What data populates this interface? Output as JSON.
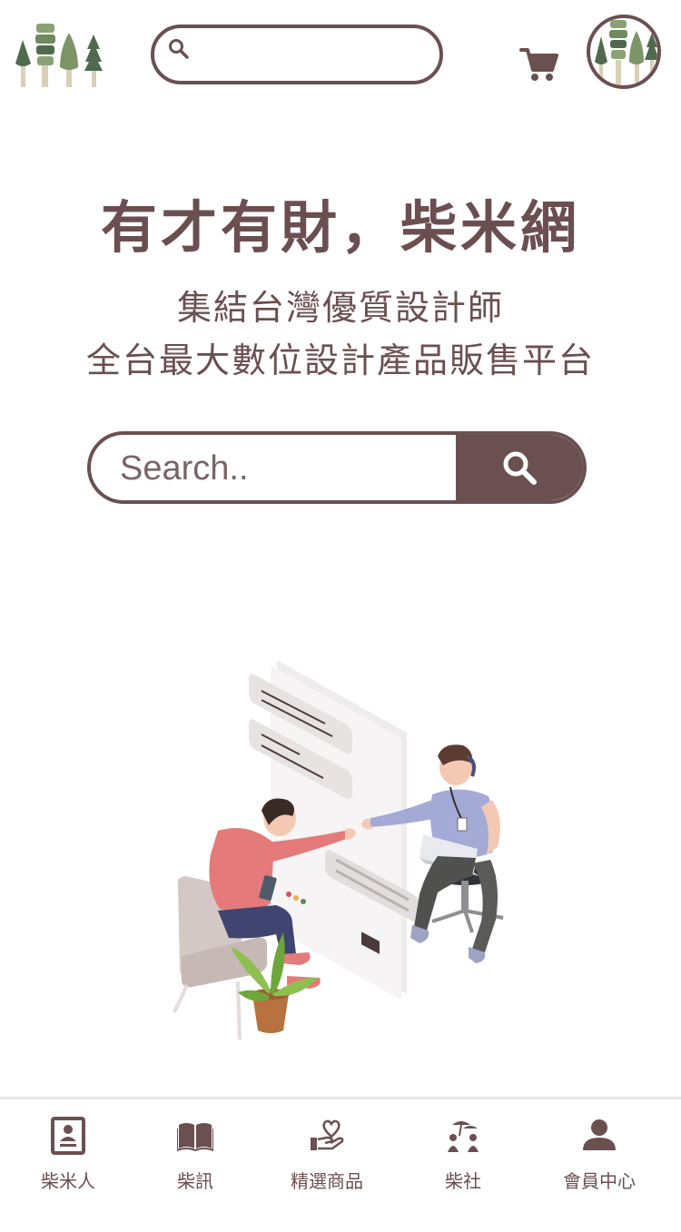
{
  "header": {
    "logo_icon": "trees-logo-icon",
    "search_icon": "search-icon",
    "search_value": "",
    "cart_icon": "cart-icon",
    "avatar_icon": "avatar-trees-icon"
  },
  "hero": {
    "title": "有才有財，柴米網",
    "subtitle_line1": "集結台灣優質設計師",
    "subtitle_line2": "全台最大數位設計產品販售平台",
    "search_placeholder": "Search..",
    "search_button_icon": "search-icon"
  },
  "illustration": {
    "icon": "designers-handshake-illustration"
  },
  "bottom_nav": {
    "items": [
      {
        "label": "柴米人",
        "icon": "profile-card-icon"
      },
      {
        "label": "柴訊",
        "icon": "open-book-icon"
      },
      {
        "label": "精選商品",
        "icon": "hand-heart-icon"
      },
      {
        "label": "柴社",
        "icon": "community-icon"
      },
      {
        "label": "會員中心",
        "icon": "user-icon"
      }
    ]
  },
  "colors": {
    "brand": "#6b5051",
    "text": "#6b4f50",
    "divider": "#e9e6e6",
    "tree_green_dark": "#4f6a4d",
    "tree_green_light": "#8aa173",
    "tree_trunk": "#d8cfb7"
  }
}
